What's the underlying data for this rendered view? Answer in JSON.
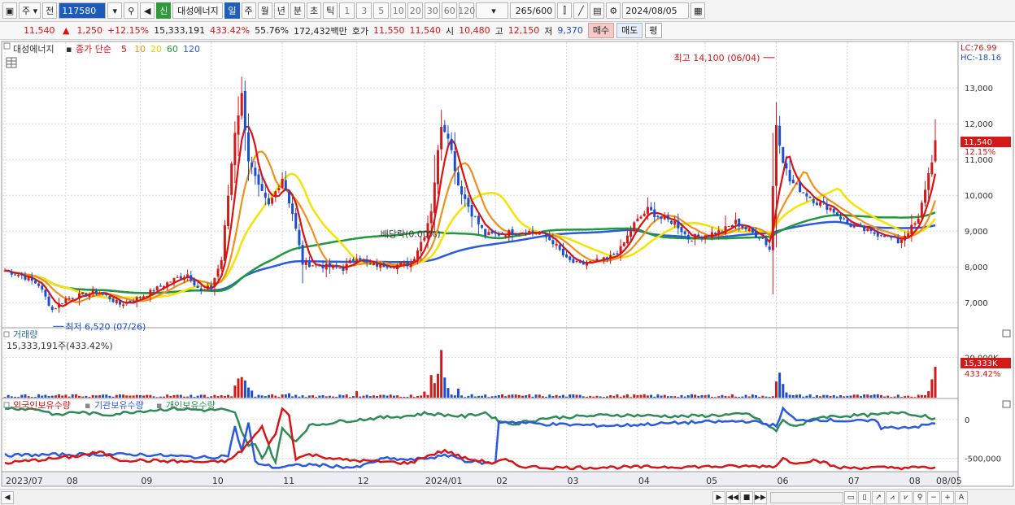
{
  "toolbar": {
    "period": "주",
    "prev": "전",
    "code": "117580",
    "new_badge": "신",
    "stock_name": "대성에너지",
    "tabs": [
      "일",
      "주",
      "월",
      "년",
      "분",
      "초",
      "틱"
    ],
    "numbers": [
      "1",
      "3",
      "5",
      "10",
      "20",
      "30",
      "60",
      "120"
    ],
    "count": "265",
    "count_max": "/600",
    "date": "2024/08/05"
  },
  "info": {
    "price": "11,540",
    "arrow": "▲",
    "change": "1,250",
    "change_pct": "+12.15%",
    "volume": "15,333,191",
    "vol_ratio": "433.42%",
    "turnover": "55.76%",
    "amount": "172,432백만",
    "ask_label": "호가",
    "ask1": "11,550",
    "ask2": "11,540",
    "open_label": "시",
    "open": "10,480",
    "high_label": "고",
    "high": "12,150",
    "low_label": "저",
    "low": "9,370",
    "buy": "매수",
    "sell": "매도",
    "avg": "평"
  },
  "colors": {
    "up": "#d11a1a",
    "down": "#1a4fd0",
    "ma5": "#e01010",
    "ma10": "#f0901a",
    "ma20": "#f5e400",
    "ma60": "#1f9a3a",
    "ma120": "#2a5ae0",
    "foreign": "#d81414",
    "institution": "#2a5ae0",
    "individual": "#2e8b57"
  },
  "chart_data": [
    {
      "type": "line",
      "panel": "price",
      "legend_name": "대성에너지",
      "legend_label": "종가 단순",
      "ma_periods": [
        "5",
        "10",
        "20",
        "60",
        "120"
      ],
      "lc_label": "LC:76.99",
      "hc_label": "HC:-18.16",
      "y_ticks": [
        "13,000",
        "12,000",
        "11,000",
        "10,000",
        "9,000",
        "8,000",
        "7,000"
      ],
      "y_tick_values": [
        13000,
        12000,
        11000,
        10000,
        9000,
        8000,
        7000
      ],
      "ylim": [
        6300,
        14300
      ],
      "x_labels": [
        "2023/07",
        "08",
        "09",
        "10",
        "11",
        "12",
        "2024/01",
        "02",
        "03",
        "04",
        "05",
        "06",
        "07",
        "08",
        "08/05"
      ],
      "x_label_index": [
        0,
        18,
        40,
        61,
        82,
        104,
        124,
        145,
        166,
        187,
        207,
        228,
        249,
        267,
        275
      ],
      "n_days": 276,
      "last_label": "11,540",
      "last_pct": "12.15%",
      "annotations": {
        "max": "최고 14,100 (06/04)",
        "min": "최저 6,520 (07/26)",
        "dividend": "배당락(0.00%)"
      },
      "anchors": [
        [
          0,
          7900
        ],
        [
          5,
          7760
        ],
        [
          10,
          7500
        ],
        [
          14,
          6800
        ],
        [
          18,
          7100
        ],
        [
          24,
          7250
        ],
        [
          28,
          7300
        ],
        [
          34,
          6950
        ],
        [
          40,
          7150
        ],
        [
          45,
          7400
        ],
        [
          50,
          7650
        ],
        [
          54,
          7800
        ],
        [
          58,
          7300
        ],
        [
          61,
          7450
        ],
        [
          64,
          8200
        ],
        [
          68,
          11800
        ],
        [
          70,
          12800
        ],
        [
          72,
          11000
        ],
        [
          75,
          10200
        ],
        [
          78,
          9700
        ],
        [
          82,
          10500
        ],
        [
          85,
          9500
        ],
        [
          88,
          8100
        ],
        [
          92,
          8050
        ],
        [
          96,
          8000
        ],
        [
          100,
          7950
        ],
        [
          104,
          8300
        ],
        [
          108,
          8050
        ],
        [
          112,
          8050
        ],
        [
          116,
          8050
        ],
        [
          120,
          8100
        ],
        [
          124,
          8900
        ],
        [
          126,
          9600
        ],
        [
          129,
          12000
        ],
        [
          131,
          11700
        ],
        [
          134,
          10300
        ],
        [
          138,
          9500
        ],
        [
          142,
          8900
        ],
        [
          145,
          8900
        ],
        [
          148,
          8950
        ],
        [
          154,
          9000
        ],
        [
          158,
          8950
        ],
        [
          162,
          8700
        ],
        [
          166,
          8200
        ],
        [
          170,
          8050
        ],
        [
          174,
          8150
        ],
        [
          178,
          8200
        ],
        [
          182,
          8500
        ],
        [
          186,
          9200
        ],
        [
          190,
          9600
        ],
        [
          194,
          9350
        ],
        [
          198,
          9250
        ],
        [
          202,
          8800
        ],
        [
          207,
          8900
        ],
        [
          212,
          9000
        ],
        [
          216,
          9250
        ],
        [
          220,
          9000
        ],
        [
          224,
          8800
        ],
        [
          226,
          8500
        ],
        [
          228,
          12000
        ],
        [
          230,
          11000
        ],
        [
          232,
          10400
        ],
        [
          236,
          10100
        ],
        [
          240,
          9800
        ],
        [
          244,
          9650
        ],
        [
          249,
          9200
        ],
        [
          252,
          9100
        ],
        [
          256,
          8950
        ],
        [
          260,
          8900
        ],
        [
          264,
          8700
        ],
        [
          267,
          9000
        ],
        [
          270,
          9300
        ],
        [
          272,
          10200
        ],
        [
          274,
          11000
        ],
        [
          275,
          11540
        ]
      ]
    },
    {
      "type": "bar",
      "panel": "volume",
      "label": "거래량",
      "current": "15,333,191주(433.42%)",
      "y_ticks": [
        "20,000K"
      ],
      "y_tick_values": [
        20000
      ],
      "ylim": [
        0,
        25000
      ],
      "last_label": "15,333K",
      "last_pct": "433.42%",
      "spikes": [
        [
          68,
          6000
        ],
        [
          69,
          9500
        ],
        [
          70,
          10200
        ],
        [
          71,
          8500
        ],
        [
          72,
          5000
        ],
        [
          73,
          3500
        ],
        [
          84,
          2200
        ],
        [
          104,
          3200
        ],
        [
          124,
          3000
        ],
        [
          126,
          11200
        ],
        [
          127,
          7200
        ],
        [
          128,
          11800
        ],
        [
          129,
          23600
        ],
        [
          130,
          10000
        ],
        [
          131,
          4800
        ],
        [
          134,
          4500
        ],
        [
          228,
          8000
        ],
        [
          229,
          12400
        ],
        [
          230,
          6800
        ],
        [
          231,
          2600
        ],
        [
          273,
          3200
        ],
        [
          274,
          9100
        ],
        [
          275,
          15300
        ]
      ]
    },
    {
      "type": "line",
      "panel": "holdings",
      "series_labels": [
        "외국인보유수량",
        "기관보유수량",
        "개인보유수량"
      ],
      "y_ticks": [
        "0",
        "-500,000"
      ],
      "y_tick_values": [
        0,
        -500000
      ],
      "ylim": [
        -650000,
        250000
      ],
      "foreign_anchors": [
        [
          0,
          -560000
        ],
        [
          20,
          -480000
        ],
        [
          28,
          -420000
        ],
        [
          34,
          -520000
        ],
        [
          61,
          -550000
        ],
        [
          66,
          -530000
        ],
        [
          70,
          -400000
        ],
        [
          73,
          -250000
        ],
        [
          76,
          -100000
        ],
        [
          78,
          -300000
        ],
        [
          80,
          -200000
        ],
        [
          82,
          150000
        ],
        [
          84,
          50000
        ],
        [
          86,
          -500000
        ],
        [
          90,
          -450000
        ],
        [
          100,
          -520000
        ],
        [
          110,
          -540000
        ],
        [
          120,
          -560000
        ],
        [
          124,
          -480000
        ],
        [
          130,
          -400000
        ],
        [
          136,
          -500000
        ],
        [
          144,
          -560000
        ],
        [
          148,
          -520000
        ],
        [
          152,
          -600000
        ],
        [
          160,
          -620000
        ],
        [
          228,
          -600000
        ],
        [
          230,
          -480000
        ],
        [
          232,
          -560000
        ],
        [
          240,
          -520000
        ],
        [
          246,
          -620000
        ],
        [
          275,
          -620000
        ]
      ],
      "institution_anchors": [
        [
          0,
          -460000
        ],
        [
          20,
          -450000
        ],
        [
          40,
          -450000
        ],
        [
          60,
          -490000
        ],
        [
          66,
          -460000
        ],
        [
          68,
          -100000
        ],
        [
          70,
          -400000
        ],
        [
          72,
          -50000
        ],
        [
          74,
          -550000
        ],
        [
          80,
          -620000
        ],
        [
          84,
          -600000
        ],
        [
          90,
          -580000
        ],
        [
          104,
          -620000
        ],
        [
          112,
          -500000
        ],
        [
          120,
          -520000
        ],
        [
          132,
          -460000
        ],
        [
          136,
          -530000
        ],
        [
          142,
          -560000
        ],
        [
          145,
          -560000
        ],
        [
          146,
          -20000
        ],
        [
          160,
          -60000
        ],
        [
          180,
          -80000
        ],
        [
          200,
          -40000
        ],
        [
          220,
          -20000
        ],
        [
          228,
          -80000
        ],
        [
          230,
          130000
        ],
        [
          232,
          60000
        ],
        [
          234,
          -20000
        ],
        [
          240,
          0
        ],
        [
          250,
          -20000
        ],
        [
          258,
          -20000
        ],
        [
          259,
          -110000
        ],
        [
          270,
          -90000
        ],
        [
          275,
          -50000
        ]
      ],
      "individual_anchors": [
        [
          0,
          150000
        ],
        [
          10,
          130000
        ],
        [
          16,
          50000
        ],
        [
          20,
          100000
        ],
        [
          30,
          60000
        ],
        [
          40,
          110000
        ],
        [
          50,
          140000
        ],
        [
          60,
          120000
        ],
        [
          64,
          130000
        ],
        [
          68,
          80000
        ],
        [
          70,
          -150000
        ],
        [
          72,
          -350000
        ],
        [
          74,
          -300000
        ],
        [
          76,
          -500000
        ],
        [
          78,
          -350000
        ],
        [
          80,
          -550000
        ],
        [
          82,
          -120000
        ],
        [
          86,
          -280000
        ],
        [
          90,
          -80000
        ],
        [
          100,
          -20000
        ],
        [
          110,
          20000
        ],
        [
          120,
          50000
        ],
        [
          124,
          80000
        ],
        [
          130,
          60000
        ],
        [
          136,
          40000
        ],
        [
          142,
          90000
        ],
        [
          146,
          -20000
        ],
        [
          150,
          -60000
        ],
        [
          160,
          20000
        ],
        [
          180,
          60000
        ],
        [
          200,
          40000
        ],
        [
          220,
          70000
        ],
        [
          228,
          -150000
        ],
        [
          230,
          0
        ],
        [
          232,
          -80000
        ],
        [
          236,
          -60000
        ],
        [
          240,
          30000
        ],
        [
          250,
          50000
        ],
        [
          258,
          60000
        ],
        [
          266,
          100000
        ],
        [
          270,
          40000
        ],
        [
          272,
          60000
        ],
        [
          275,
          0
        ]
      ]
    }
  ]
}
